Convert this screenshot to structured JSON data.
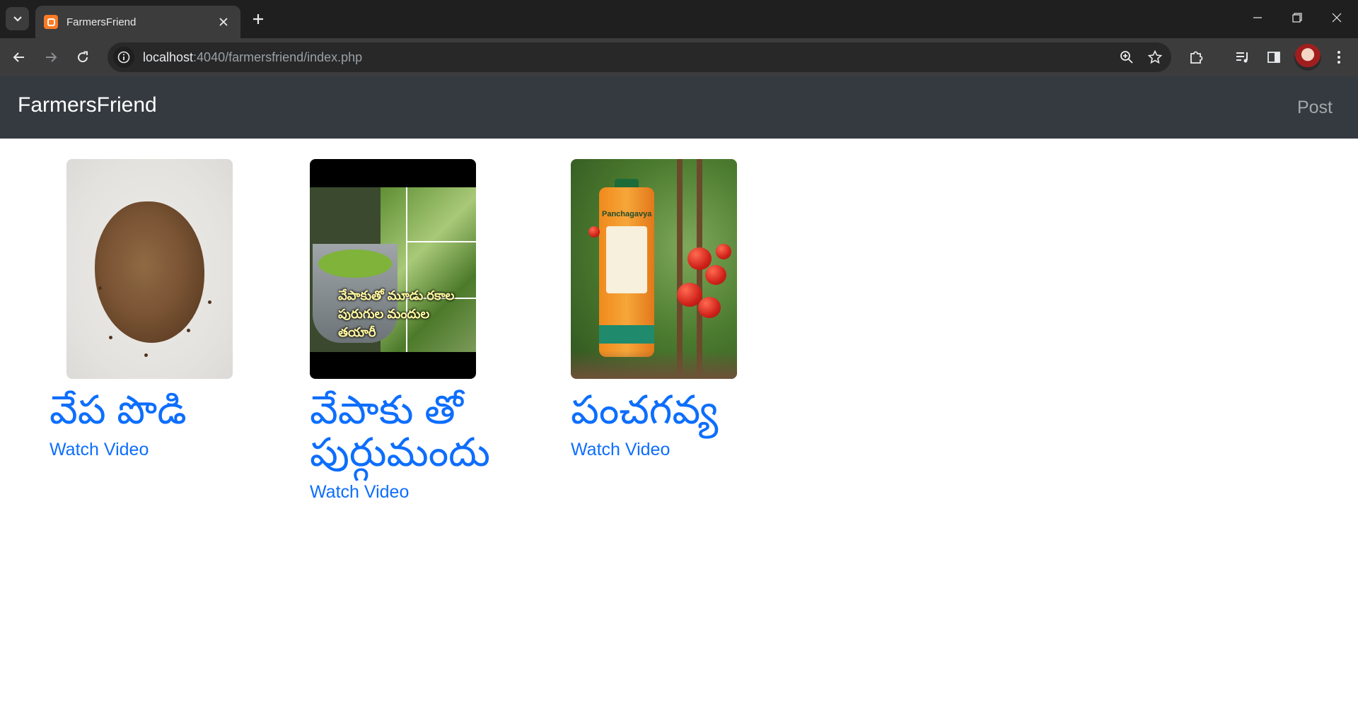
{
  "browser": {
    "tab_title": "FarmersFriend",
    "url_host": "localhost",
    "url_rest": ":4040/farmersfriend/index.php"
  },
  "navbar": {
    "brand": "FarmersFriend",
    "post_link": "Post"
  },
  "cards": [
    {
      "title": "వేప పొడి",
      "link": "Watch Video",
      "image": "neem-powder-image"
    },
    {
      "title": "వేపాకు తో పుర్గుమందు",
      "link": "Watch Video",
      "image": "neem-leaf-pesticide-video-thumbnail",
      "thumbnail_text": "వేపాకుతో మూడు రకాల పురుగుల మందుల తయారీ"
    },
    {
      "title": "పంచగవ్య",
      "link": "Watch Video",
      "image": "panchagavya-bottle-image",
      "bottle_label": "Panchagavya"
    }
  ],
  "colors": {
    "navbar_bg": "#343a40",
    "link_blue": "#0d6efd"
  }
}
